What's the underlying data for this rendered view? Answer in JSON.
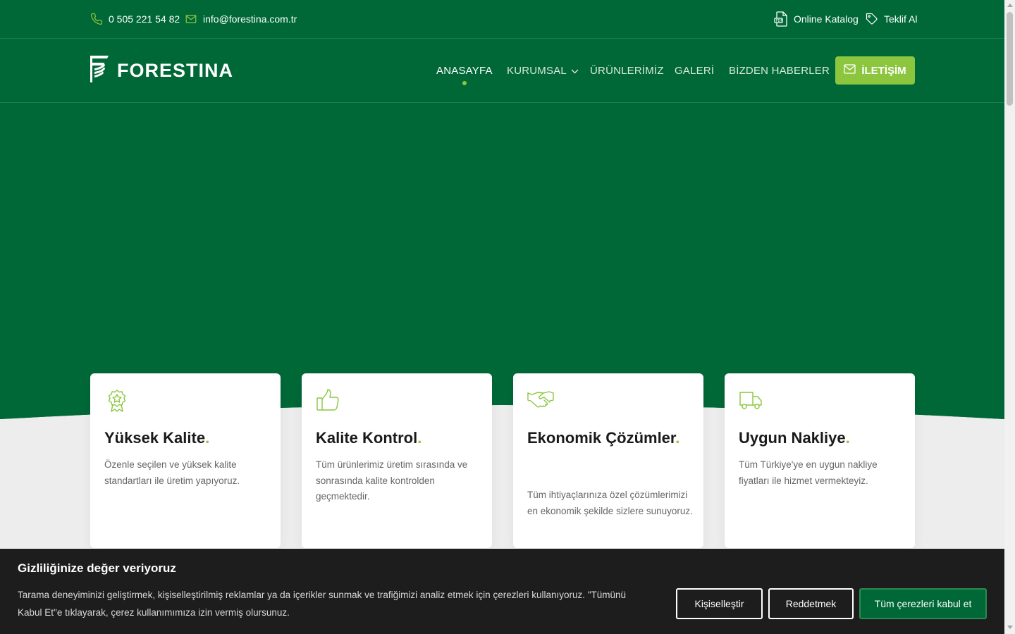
{
  "topbar": {
    "phone": "0 505 221 54 82",
    "email": "info@forestina.com.tr",
    "catalog": "Online Katalog",
    "quote": "Teklif Al",
    "icons": {
      "phone": "phone-icon",
      "email": "mail-icon",
      "catalog": "pdf-document-icon",
      "quote": "tag-icon"
    }
  },
  "header": {
    "logo_text": "FORESTINA",
    "nav": [
      {
        "label": "ANASAYFA",
        "active": true
      },
      {
        "label": "KURUMSAL",
        "has_dropdown": true
      },
      {
        "label": "ÜRÜNLERİMİZ"
      },
      {
        "label": "GALERİ"
      },
      {
        "label": "BİZDEN HABERLER"
      }
    ],
    "contact_button": "İLETİŞİM"
  },
  "features": [
    {
      "title": "Yüksek Kalite",
      "dot": ".",
      "text": "Özenle seçilen ve yüksek kalite standartları ile üretim yapıyoruz.",
      "icon": "award-badge-icon"
    },
    {
      "title": "Kalite Kontrol",
      "dot": ".",
      "text": "Tüm ürünlerimiz üretim sırasında ve sonrasında kalite kontrolden geçmektedir.",
      "icon": "thumbs-up-icon"
    },
    {
      "title": "Ekonomik Çözümler",
      "dot": ".",
      "text": "Tüm ihtiyaçlarınıza özel çözümlerimizi en ekonomik şekilde sizlere sunuyoruz.",
      "icon": "handshake-icon"
    },
    {
      "title": "Uygun Nakliye",
      "dot": ".",
      "text": "Tüm Türkiye'ye en uygun nakliye fiyatları ile hizmet vermekteyiz.",
      "icon": "truck-icon"
    }
  ],
  "cookie": {
    "title": "Gizliliğinize değer veriyoruz",
    "text": "Tarama deneyiminizi geliştirmek, kişiselleştirilmiş reklamlar ya da içerikler sunmak ve trafiğimizi analiz etmek için çerezleri kullanıyoruz. \"Tümünü Kabul Et\"e tıklayarak, çerez kullanımımıza izin vermiş olursunuz.",
    "customize": "Kişiselleştir",
    "reject": "Reddetmek",
    "accept": "Tüm çerezleri kabul et"
  },
  "colors": {
    "brand_green": "#006837",
    "accent_green": "#8cc63f",
    "cookie_bg": "#1d1d1d"
  }
}
